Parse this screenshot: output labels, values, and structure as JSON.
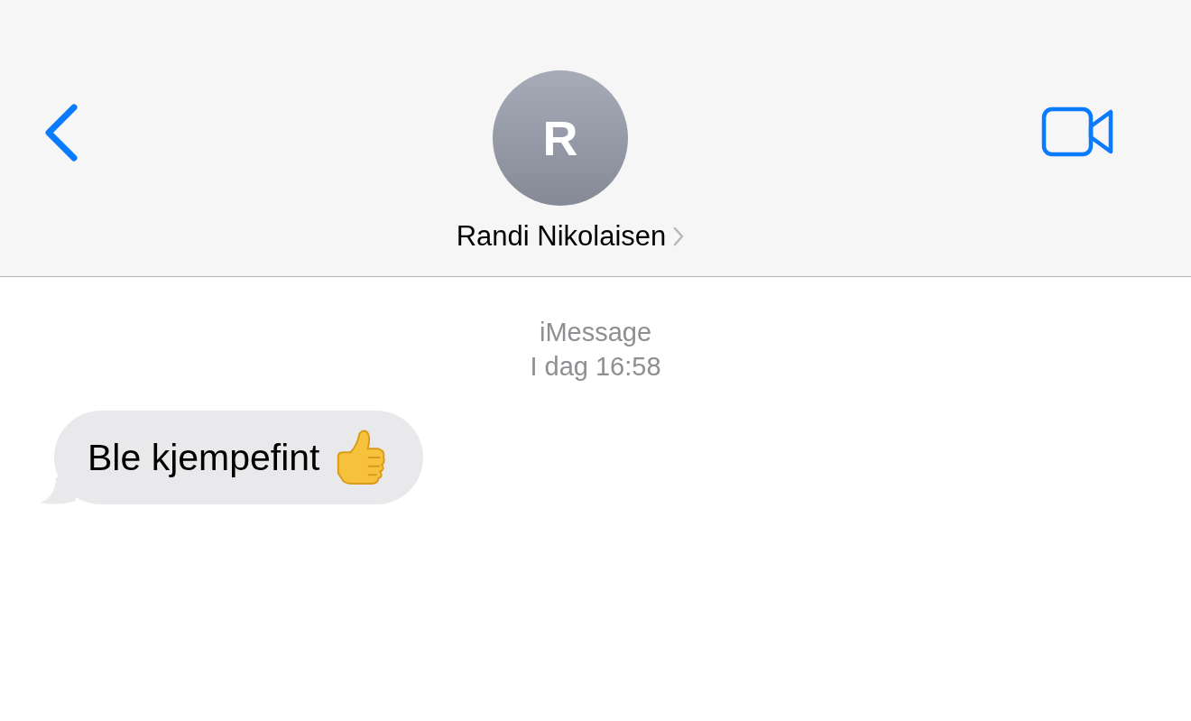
{
  "header": {
    "avatar_initial": "R",
    "contact_name": "Randi Nikolaisen"
  },
  "service": "iMessage",
  "timestamp": "I dag 16:58",
  "messages": [
    {
      "kind": "incoming",
      "text": "Ble kjempefint"
    }
  ]
}
